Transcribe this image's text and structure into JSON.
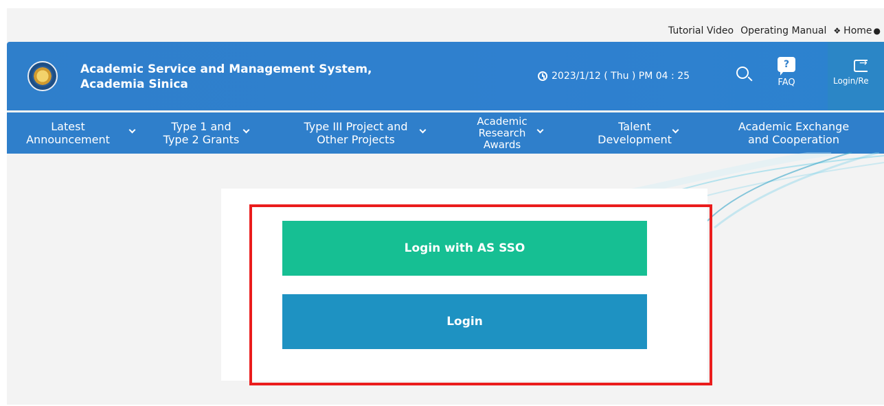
{
  "utility_links": {
    "tutorial_video": "Tutorial Video",
    "operating_manual": "Operating Manual",
    "home": "Home",
    "home_icon": "home-icon",
    "language_icon": "globe-icon"
  },
  "header": {
    "title_line1": "Academic Service and Management System,",
    "title_line2": "Academia Sinica",
    "datetime": "2023/1/12 ( Thu ) PM 04 : 25",
    "faq_label": "FAQ",
    "faq_glyph": "?",
    "login_register_label": "Login/Re",
    "colors": {
      "header_bg": "#2f7fcb",
      "login_panel_bg": "#2b86c6"
    }
  },
  "nav": {
    "items": [
      {
        "line1": "Latest",
        "line2": "Announcement"
      },
      {
        "line1": "Type 1 and",
        "line2": "Type 2 Grants"
      },
      {
        "line1": "Type III Project and",
        "line2": "Other Projects"
      },
      {
        "line1": "Academic",
        "line2": "Research",
        "line3": "Awards"
      },
      {
        "line1": "Talent",
        "line2": "Development"
      },
      {
        "line1": "Academic Exchange",
        "line2": "and Cooperation"
      }
    ]
  },
  "login_card": {
    "sso_button": "Login with AS SSO",
    "login_button": "Login",
    "colors": {
      "sso": "#16bf93",
      "login": "#1e92c2",
      "highlight": "#ea1c1c"
    }
  }
}
